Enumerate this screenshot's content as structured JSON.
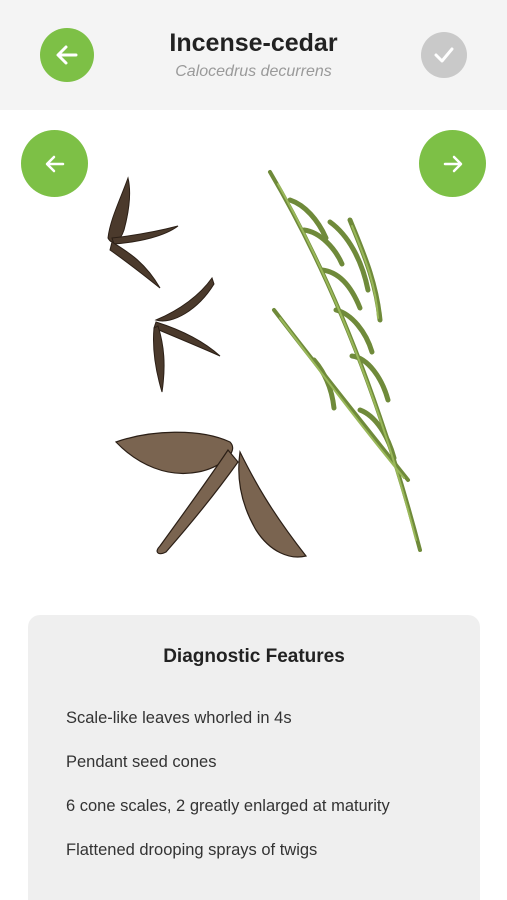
{
  "header": {
    "title": "Incense-cedar",
    "subtitle": "Calocedrus decurrens"
  },
  "icons": {
    "back": "arrow-left-icon",
    "done": "checkmark-icon",
    "prev": "arrow-left-icon",
    "next": "arrow-right-icon"
  },
  "colors": {
    "accent": "#7dc046",
    "disabled": "#c9c9c9",
    "header_bg": "#f4f4f4",
    "panel_bg": "#efefef"
  },
  "features_panel": {
    "title": "Diagnostic Features",
    "items": [
      "Scale-like leaves whorled in 4s",
      "Pendant seed cones",
      "6 cone scales, 2 greatly enlarged at maturity",
      "Flattened drooping sprays of twigs"
    ]
  }
}
